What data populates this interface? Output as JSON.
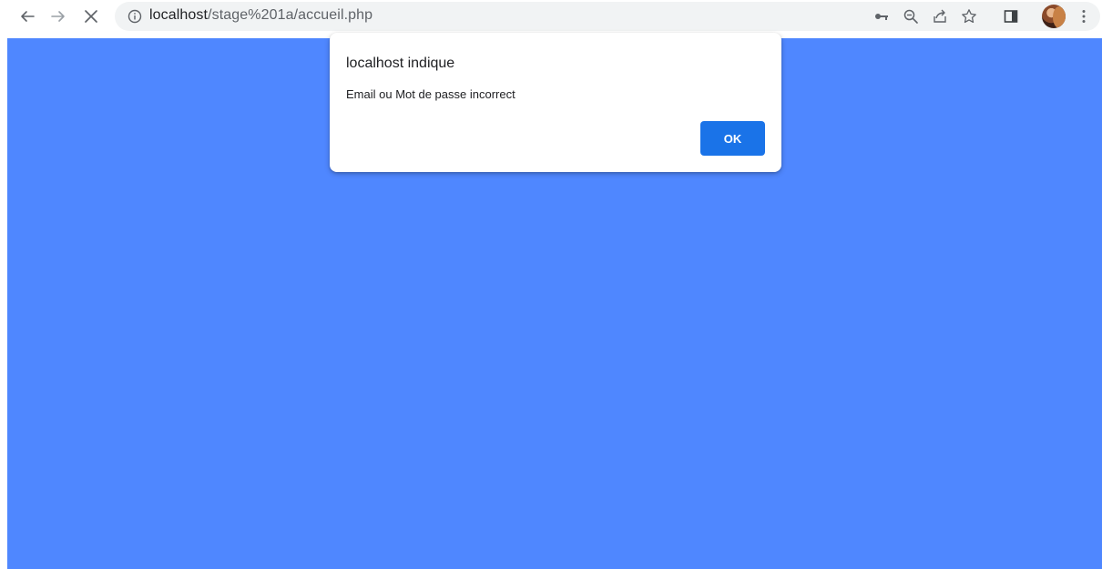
{
  "browser": {
    "url_host": "localhost",
    "url_path": "/stage%201a/accueil.php",
    "icons": {
      "back": "arrow-left-icon",
      "forward": "arrow-right-icon",
      "stop": "close-icon",
      "site_info": "info-icon",
      "password": "key-icon",
      "zoom": "zoom-out-icon",
      "share": "share-icon",
      "bookmark": "star-icon",
      "side_panel": "side-panel-icon",
      "profile": "avatar",
      "menu": "kebab-menu-icon"
    }
  },
  "page": {
    "background_color": "#4f87ff"
  },
  "alert": {
    "title": "localhost indique",
    "message": "Email ou Mot de passe incorrect",
    "ok_label": "OK",
    "button_color": "#1a73e8"
  }
}
